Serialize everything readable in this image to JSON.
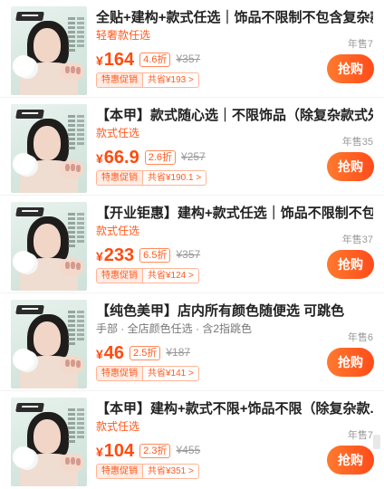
{
  "products": [
    {
      "title": "全贴+建构+款式任选｜饰品不限制不包含复杂款",
      "subtitle": "轻奢款任选",
      "subtitle_style": "orange",
      "sold": "年售7",
      "currency": "¥",
      "price": "164",
      "discount": "4.6折",
      "original_price": "¥357",
      "promo_tag": "特惠促销",
      "save_tag": "共省¥193 >",
      "buy_label": "抢购"
    },
    {
      "title": "【本甲】款式随心选｜不限饰品（除复杂款式外）",
      "subtitle": "款式任选",
      "subtitle_style": "orange",
      "sold": "年售35",
      "currency": "¥",
      "price": "66.9",
      "discount": "2.6折",
      "original_price": "¥257",
      "promo_tag": "特惠促销",
      "save_tag": "共省¥190.1 >",
      "buy_label": "抢购"
    },
    {
      "title": "【开业钜惠】建构+款式任选｜饰品不限制不包...",
      "subtitle": "款式任选",
      "subtitle_style": "orange",
      "sold": "年售37",
      "currency": "¥",
      "price": "233",
      "discount": "6.5折",
      "original_price": "¥357",
      "promo_tag": "特惠促销",
      "save_tag": "共省¥124 >",
      "buy_label": "抢购"
    },
    {
      "title": "【纯色美甲】店内所有颜色随便选 可跳色",
      "subtitle": "手部 · 全店颜色任选 · 含2指跳色",
      "subtitle_style": "gray",
      "sold": "年售6",
      "currency": "¥",
      "price": "46",
      "discount": "2.5折",
      "original_price": "¥187",
      "promo_tag": "特惠促销",
      "save_tag": "共省¥141 >",
      "buy_label": "抢购"
    },
    {
      "title": "【本甲】建构+款式不限+饰品不限（除复杂款...",
      "subtitle": "款式任选",
      "subtitle_style": "orange",
      "sold": "年售7",
      "currency": "¥",
      "price": "104",
      "discount": "2.3折",
      "original_price": "¥455",
      "promo_tag": "特惠促销",
      "save_tag": "共省¥351 >",
      "buy_label": "抢购"
    }
  ],
  "colors": {
    "accent": "#ff4b0f",
    "button_gradient_start": "#ff7a2e",
    "button_gradient_end": "#ff4b1a",
    "thumbnail_background": "#d7e8e1"
  }
}
